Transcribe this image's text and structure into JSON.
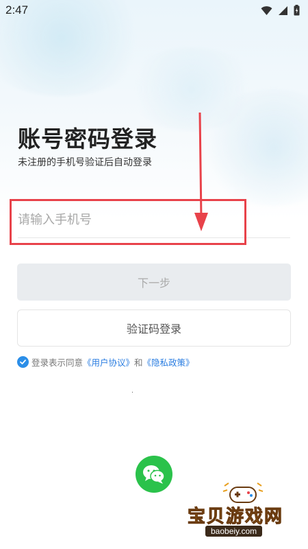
{
  "status_bar": {
    "time": "2:47",
    "icons": [
      "wifi-icon",
      "signal-icon",
      "battery-icon"
    ]
  },
  "header": {
    "title": "账号密码登录",
    "subtitle": "未注册的手机号验证后自动登录"
  },
  "form": {
    "phone_placeholder": "请输入手机号",
    "phone_value": "",
    "next_label": "下一步",
    "code_login_label": "验证码登录"
  },
  "agreement": {
    "checked": true,
    "prefix": "登录表示同意",
    "user_agreement": "《用户协议》",
    "conjunction": "和",
    "privacy_policy": "《隐私政策》"
  },
  "social": {
    "wechat_icon": "wechat-icon"
  },
  "watermark": {
    "title": "宝贝游戏网",
    "url": "baobeiy.com"
  },
  "colors": {
    "highlight": "#e8424a",
    "link": "#2a7de1",
    "wechat": "#2bc24b",
    "disabled_button": "#e9ecef"
  }
}
